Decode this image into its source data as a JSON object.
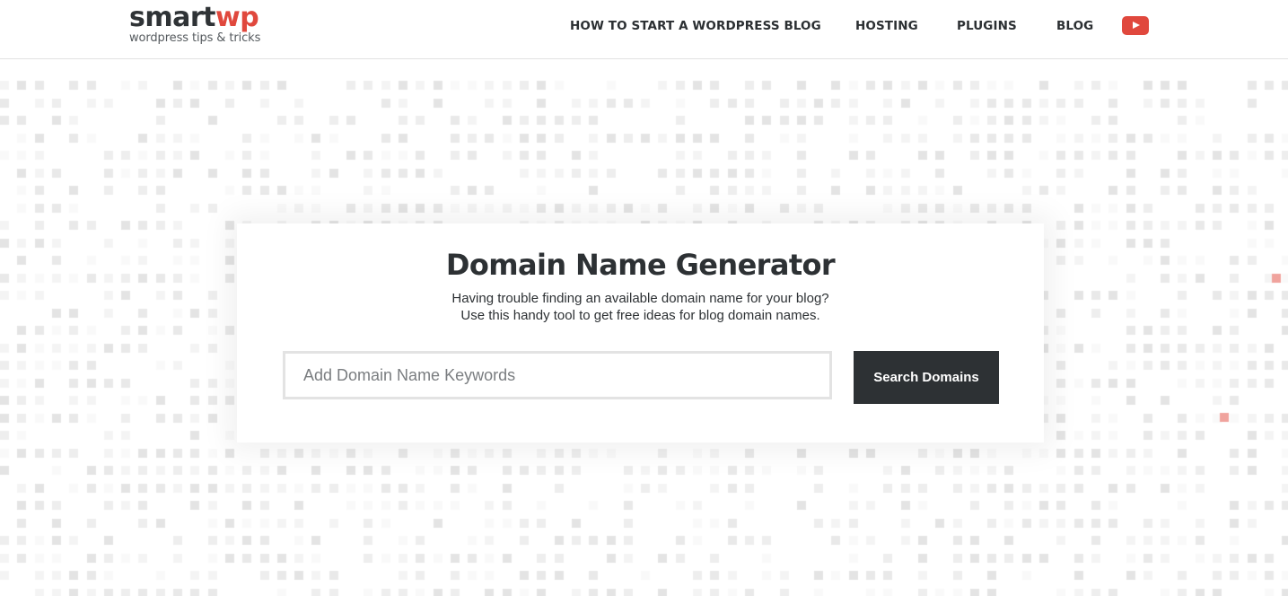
{
  "header": {
    "logo": {
      "part1": "smart",
      "part2": "wp",
      "tagline": "wordpress tips & tricks"
    },
    "nav": [
      {
        "label": "HOW TO START A WORDPRESS BLOG"
      },
      {
        "label": "HOSTING"
      },
      {
        "label": "PLUGINS"
      },
      {
        "label": "BLOG"
      }
    ],
    "social_icon": "youtube-icon"
  },
  "tool": {
    "title": "Domain Name Generator",
    "subtitle_line1": "Having trouble finding an available domain name for your blog?",
    "subtitle_line2": "Use this handy tool to get free ideas for blog domain names.",
    "input": {
      "value": "",
      "placeholder": "Add Domain Name Keywords"
    },
    "button_label": "Search Domains"
  },
  "colors": {
    "brand_red": "#e0483d",
    "dark": "#2d3134",
    "pattern_gray": "#e6e6e6",
    "pattern_accent": "#f0a39d"
  }
}
